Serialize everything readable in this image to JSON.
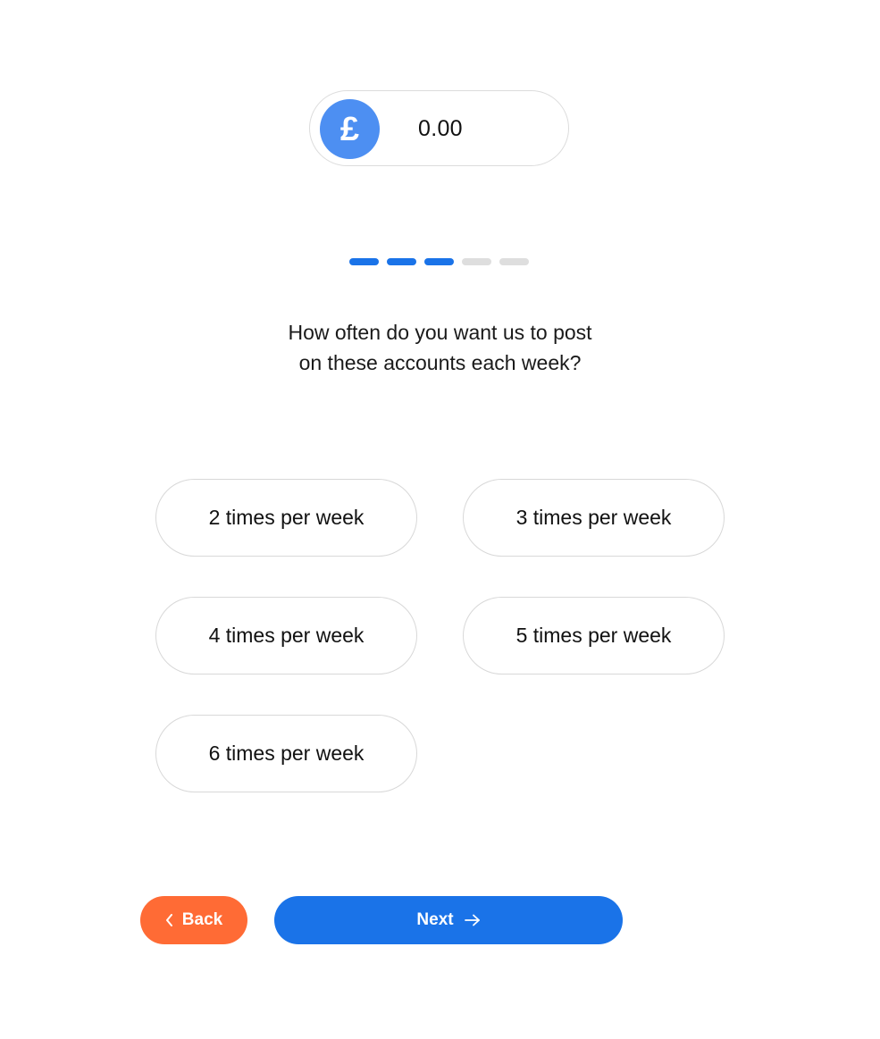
{
  "price": {
    "currency_symbol": "£",
    "amount": "0.00"
  },
  "progress": {
    "total_steps": 5,
    "completed_steps": 3
  },
  "question": {
    "line1": "How often do you want us to post",
    "line2": "on these accounts each week?"
  },
  "options": [
    {
      "label": "2 times per week"
    },
    {
      "label": "3 times per week"
    },
    {
      "label": "4 times per week"
    },
    {
      "label": "5 times per week"
    },
    {
      "label": "6 times per week"
    }
  ],
  "nav": {
    "back_label": "Back",
    "next_label": "Next"
  },
  "colors": {
    "primary": "#1a73e8",
    "back": "#ff6b35",
    "currency_badge": "#4d8ff2",
    "step_inactive": "#dedede"
  }
}
